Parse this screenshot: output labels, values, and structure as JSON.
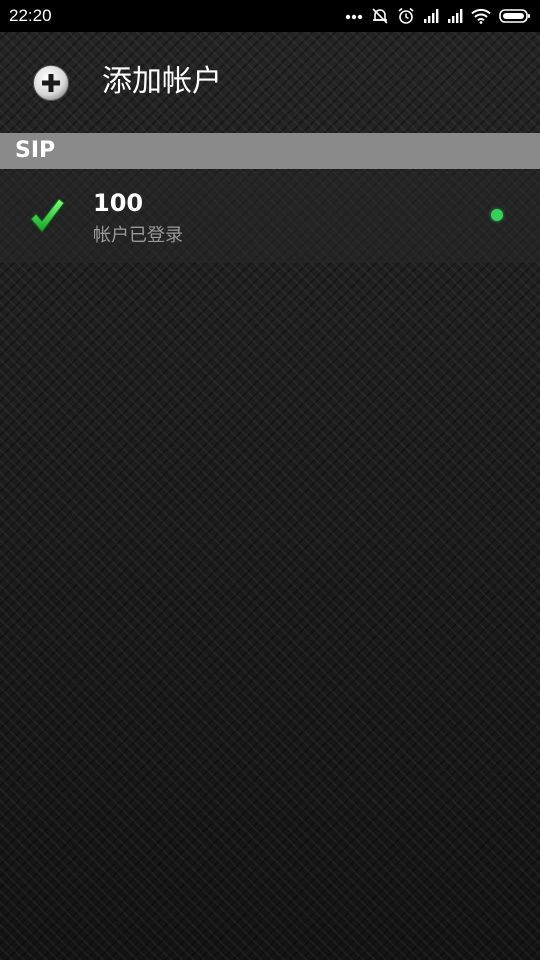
{
  "status_bar": {
    "time": "22:20",
    "icons": [
      "more-dots-icon",
      "alarm-off-icon",
      "alarm-clock-icon",
      "signal-icon",
      "signal-icon",
      "wifi-icon",
      "battery-icon"
    ]
  },
  "header": {
    "add_label": "添加帐户",
    "add_icon": "plus-circle-icon"
  },
  "sections": [
    {
      "title": "SIP",
      "accounts": [
        {
          "name": "100",
          "status": "帐户已登录",
          "checked": true,
          "online": true,
          "status_color": "#34d05a"
        }
      ]
    }
  ],
  "colors": {
    "section_header_bg": "#8a8a8a",
    "check_green": "#2ecc40",
    "online_green": "#34d05a"
  }
}
